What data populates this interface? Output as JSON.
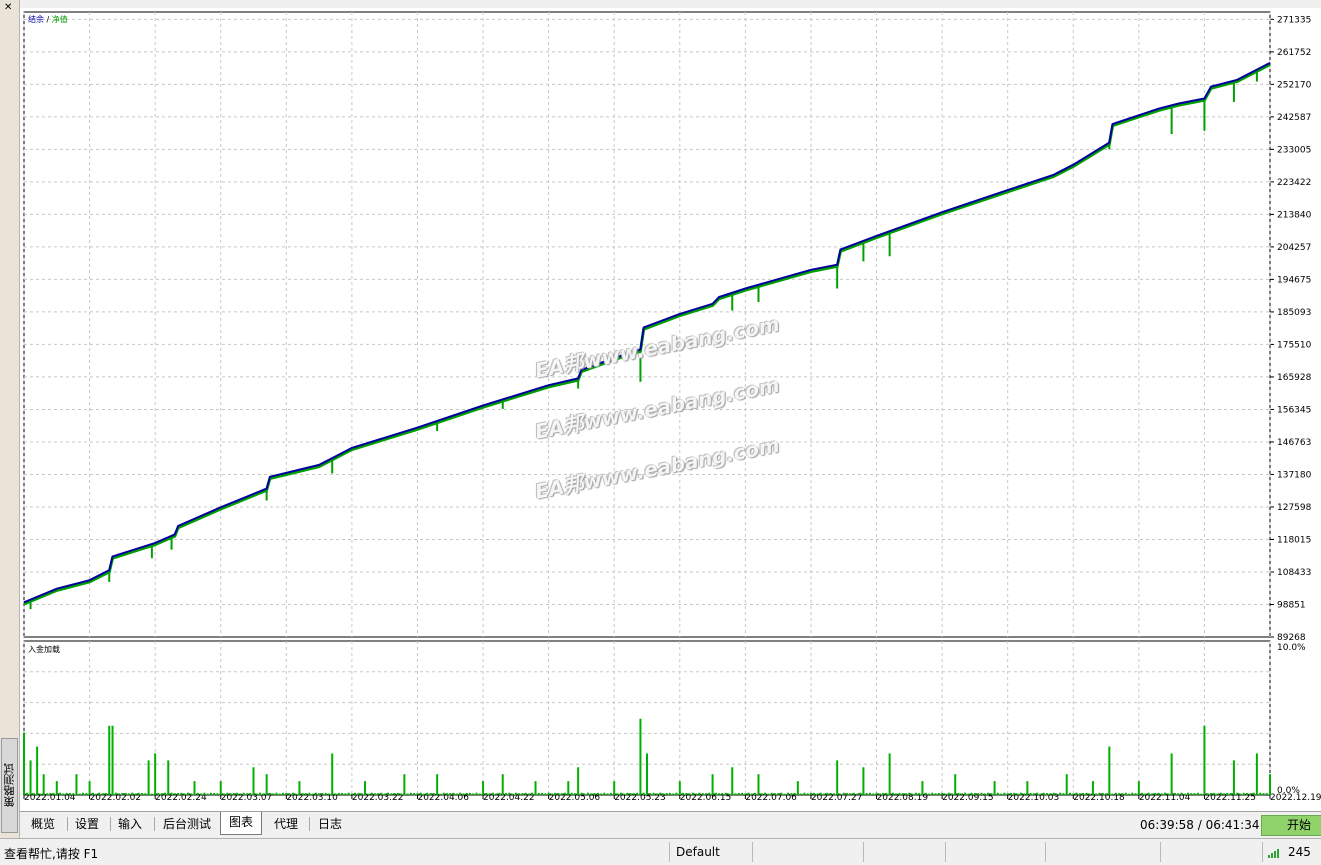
{
  "window": {
    "close_glyph": "✕",
    "side_tab_label": "策略测试"
  },
  "chart_data": [
    {
      "type": "line",
      "title": "",
      "legend": [
        {
          "name": "结余",
          "color": "#0000a0"
        },
        {
          "name": "净值",
          "color": "#00a000"
        }
      ],
      "legend_separator": "/",
      "legend_position": "top-left",
      "y_ticks": [
        271335,
        261752,
        252170,
        242587,
        233005,
        223422,
        213840,
        204257,
        194675,
        185093,
        175510,
        165928,
        156345,
        146763,
        137180,
        127598,
        118015,
        108433,
        98851,
        89268
      ],
      "ylim": [
        89268,
        273500
      ],
      "x_labels": [
        "2022.01.04",
        "2022.02.02",
        "2022.02.24",
        "2022.03.07",
        "2022.03.10",
        "2022.03.22",
        "2022.04.06",
        "2022.04.22",
        "2022.05.06",
        "2022.05.23",
        "2022.06.15",
        "2022.07.06",
        "2022.07.27",
        "2022.08.19",
        "2022.09.15",
        "2022.10.03",
        "2022.10.18",
        "2022.11.04",
        "2022.11.25",
        "2022.12.19"
      ],
      "grid": true,
      "series": [
        {
          "name": "结余",
          "color": "#0000a0",
          "x": [
            0,
            0.5,
            1.0,
            1.3,
            1.35,
            2.0,
            2.3,
            2.35,
            3.0,
            3.7,
            3.75,
            4.5,
            5.0,
            6.0,
            7.0,
            8.0,
            8.45,
            8.5,
            9.0,
            9.4,
            9.45,
            10.0,
            10.5,
            10.6,
            11.0,
            12.0,
            12.4,
            12.45,
            13.0,
            14.0,
            15.0,
            15.7,
            16.0,
            16.55,
            16.6,
            17.3,
            17.6,
            18.0,
            18.1,
            18.5,
            19.0
          ],
          "y": [
            99500,
            103500,
            106000,
            109000,
            113000,
            117000,
            119500,
            122000,
            127500,
            133000,
            136500,
            140000,
            145000,
            151000,
            157500,
            163500,
            165500,
            168000,
            171500,
            174000,
            180500,
            184500,
            187500,
            189500,
            192000,
            197500,
            199000,
            203500,
            207500,
            214500,
            221000,
            225500,
            228500,
            235000,
            240500,
            245000,
            246500,
            248000,
            251500,
            253500,
            258500
          ]
        },
        {
          "name": "净值",
          "color": "#00a000",
          "x": [
            0,
            0.5,
            1.0,
            1.3,
            1.35,
            2.0,
            2.3,
            2.35,
            3.0,
            3.7,
            3.75,
            4.5,
            5.0,
            6.0,
            7.0,
            8.0,
            8.45,
            8.5,
            9.0,
            9.4,
            9.45,
            10.0,
            10.5,
            10.6,
            11.0,
            12.0,
            12.4,
            12.45,
            13.0,
            14.0,
            15.0,
            15.7,
            16.0,
            16.55,
            16.6,
            17.3,
            17.6,
            18.0,
            18.1,
            18.5,
            19.0
          ],
          "y": [
            99000,
            103000,
            105500,
            108500,
            112500,
            116500,
            119000,
            121500,
            127000,
            132500,
            136000,
            139500,
            144500,
            150500,
            157000,
            163000,
            165000,
            167500,
            171000,
            173500,
            180000,
            184000,
            187000,
            189000,
            191500,
            197000,
            198500,
            203000,
            207000,
            214000,
            220500,
            225000,
            228000,
            234500,
            240000,
            244500,
            246000,
            247500,
            251000,
            253000,
            258000
          ]
        }
      ],
      "equity_dips": [
        {
          "x": 0.1,
          "y": 97500
        },
        {
          "x": 1.3,
          "y": 105500
        },
        {
          "x": 1.95,
          "y": 112500
        },
        {
          "x": 2.25,
          "y": 115000
        },
        {
          "x": 3.7,
          "y": 129500
        },
        {
          "x": 4.7,
          "y": 137500
        },
        {
          "x": 6.3,
          "y": 150000
        },
        {
          "x": 7.3,
          "y": 156500
        },
        {
          "x": 8.45,
          "y": 162500
        },
        {
          "x": 9.4,
          "y": 164500
        },
        {
          "x": 10.8,
          "y": 185500
        },
        {
          "x": 11.2,
          "y": 188000
        },
        {
          "x": 12.4,
          "y": 192000
        },
        {
          "x": 12.8,
          "y": 200000
        },
        {
          "x": 13.2,
          "y": 201500
        },
        {
          "x": 17.5,
          "y": 237500
        },
        {
          "x": 18.0,
          "y": 238500
        },
        {
          "x": 18.45,
          "y": 247000
        },
        {
          "x": 16.55,
          "y": 233000
        },
        {
          "x": 18.8,
          "y": 253000
        }
      ]
    },
    {
      "type": "bar",
      "title": "入金加载",
      "color": "#00b000",
      "ylim": [
        0,
        10
      ],
      "y_tick_labels": [
        "10.0%",
        "0.0%"
      ],
      "bars": [
        {
          "x": 0.0,
          "v": 0.9
        },
        {
          "x": 0.1,
          "v": 0.5
        },
        {
          "x": 0.2,
          "v": 0.7
        },
        {
          "x": 0.3,
          "v": 0.3
        },
        {
          "x": 0.5,
          "v": 0.2
        },
        {
          "x": 0.8,
          "v": 0.3
        },
        {
          "x": 1.0,
          "v": 0.2
        },
        {
          "x": 1.3,
          "v": 1.0
        },
        {
          "x": 1.35,
          "v": 1.0
        },
        {
          "x": 1.9,
          "v": 0.5
        },
        {
          "x": 2.0,
          "v": 0.6
        },
        {
          "x": 2.2,
          "v": 0.5
        },
        {
          "x": 2.6,
          "v": 0.2
        },
        {
          "x": 3.0,
          "v": 0.2
        },
        {
          "x": 3.5,
          "v": 0.4
        },
        {
          "x": 3.7,
          "v": 0.3
        },
        {
          "x": 4.2,
          "v": 0.2
        },
        {
          "x": 4.7,
          "v": 0.6
        },
        {
          "x": 5.2,
          "v": 0.2
        },
        {
          "x": 5.8,
          "v": 0.3
        },
        {
          "x": 6.3,
          "v": 0.3
        },
        {
          "x": 7.0,
          "v": 0.2
        },
        {
          "x": 7.3,
          "v": 0.3
        },
        {
          "x": 7.8,
          "v": 0.2
        },
        {
          "x": 8.3,
          "v": 0.2
        },
        {
          "x": 8.45,
          "v": 0.4
        },
        {
          "x": 9.0,
          "v": 0.2
        },
        {
          "x": 9.4,
          "v": 1.1
        },
        {
          "x": 9.5,
          "v": 0.6
        },
        {
          "x": 10.0,
          "v": 0.2
        },
        {
          "x": 10.5,
          "v": 0.3
        },
        {
          "x": 10.8,
          "v": 0.4
        },
        {
          "x": 11.2,
          "v": 0.3
        },
        {
          "x": 11.8,
          "v": 0.2
        },
        {
          "x": 12.4,
          "v": 0.5
        },
        {
          "x": 12.8,
          "v": 0.4
        },
        {
          "x": 13.2,
          "v": 0.6
        },
        {
          "x": 13.7,
          "v": 0.2
        },
        {
          "x": 14.2,
          "v": 0.3
        },
        {
          "x": 14.8,
          "v": 0.2
        },
        {
          "x": 15.3,
          "v": 0.2
        },
        {
          "x": 15.9,
          "v": 0.3
        },
        {
          "x": 16.3,
          "v": 0.2
        },
        {
          "x": 16.55,
          "v": 0.7
        },
        {
          "x": 17.0,
          "v": 0.2
        },
        {
          "x": 17.5,
          "v": 0.6
        },
        {
          "x": 18.0,
          "v": 1.0
        },
        {
          "x": 18.45,
          "v": 0.5
        },
        {
          "x": 18.8,
          "v": 0.6
        },
        {
          "x": 19.0,
          "v": 0.3
        }
      ]
    }
  ],
  "watermarks": [
    "EA邦www.eabang.com",
    "EA邦www.eabang.com",
    "EA邦www.eabang.com"
  ],
  "tabs": [
    {
      "label": "概览"
    },
    {
      "label": "设置"
    },
    {
      "label": "输入"
    },
    {
      "label": "后台测试"
    },
    {
      "label": "图表",
      "active": true
    },
    {
      "label": "代理"
    },
    {
      "label": "日志"
    }
  ],
  "timer": "06:39:58 / 06:41:34",
  "start_button": "开始",
  "status": {
    "help": "查看帮忙,请按 F1",
    "profile": "Default",
    "connection": "245"
  },
  "colors": {
    "balance": "#0000a0",
    "equity": "#00a000",
    "load_bar": "#00b000",
    "grid": "#c8c8c8",
    "start_button": "#8fd36a"
  }
}
